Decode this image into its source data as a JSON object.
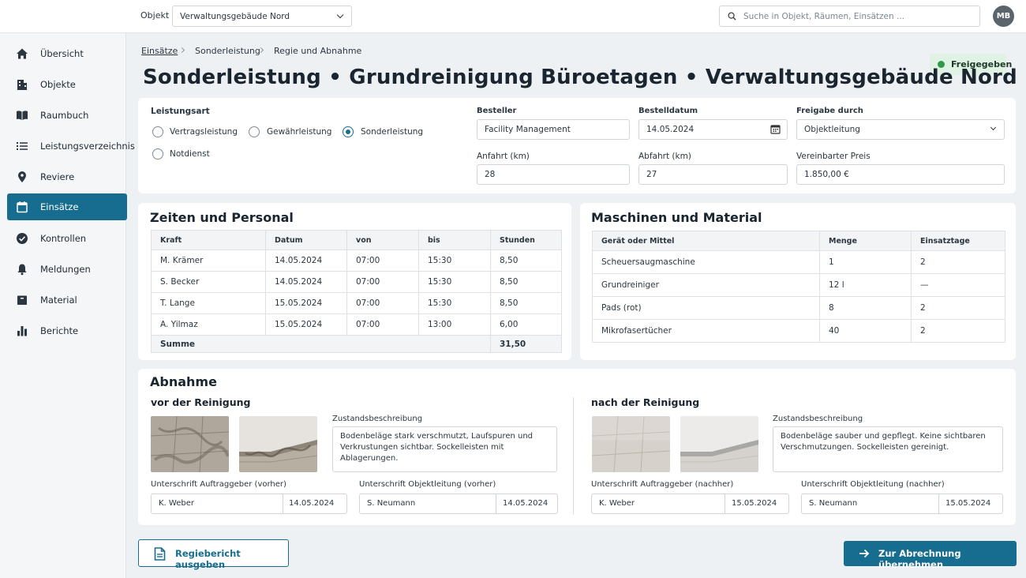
{
  "topbar": {
    "object_label": "Objekt",
    "object_value": "Verwaltungsgebäude Nord",
    "search_placeholder": "Suche in Objekt, Räumen, Einsätzen ...",
    "avatar_initials": "MB"
  },
  "sidebar": {
    "items": [
      {
        "label": "Übersicht",
        "icon": "home-icon",
        "active": false
      },
      {
        "label": "Objekte",
        "icon": "building-icon",
        "active": false
      },
      {
        "label": "Raumbuch",
        "icon": "book-icon",
        "active": false
      },
      {
        "label": "Leistungsverzeichnis",
        "icon": "list-icon",
        "active": false
      },
      {
        "label": "Reviere",
        "icon": "map-pin-icon",
        "active": false
      },
      {
        "label": "Einsätze",
        "icon": "calendar-icon",
        "active": true
      },
      {
        "label": "Kontrollen",
        "icon": "check-circle-icon",
        "active": false
      },
      {
        "label": "Meldungen",
        "icon": "bell-icon",
        "active": false
      },
      {
        "label": "Material",
        "icon": "box-icon",
        "active": false
      },
      {
        "label": "Berichte",
        "icon": "bar-chart-icon",
        "active": false
      }
    ]
  },
  "breadcrumb": [
    "Einsätze",
    "Sonderleistung",
    "Regie und Abnahme"
  ],
  "status_badge": "Freigegeben",
  "page_title": "Sonderleistung • Grundreinigung Büroetagen • Verwaltungsgebäude Nord",
  "form": {
    "leistungsart_label": "Leistungsart",
    "options": [
      "Vertragsleistung",
      "Gewährleistung",
      "Sonderleistung",
      "Notdienst"
    ],
    "selected": "Sonderleistung",
    "besteller_label": "Besteller",
    "besteller": "Facility Management",
    "bestelldatum_label": "Bestelldatum",
    "bestelldatum": "14.05.2024",
    "freigabe_label": "Freigabe durch",
    "freigabe": "Objektleitung",
    "anfahrt_label": "Anfahrt (km)",
    "anfahrt": "28",
    "abfahrt_label": "Abfahrt (km)",
    "abfahrt": "27",
    "preis_label": "Vereinbarter Preis",
    "preis": "1.850,00 €"
  },
  "personal": {
    "title": "Zeiten und Personal",
    "headers": [
      "Kraft",
      "Datum",
      "von",
      "bis",
      "Stunden"
    ],
    "rows": [
      [
        "M. Krämer",
        "14.05.2024",
        "07:00",
        "15:30",
        "8,50"
      ],
      [
        "S. Becker",
        "14.05.2024",
        "07:00",
        "15:30",
        "8,50"
      ],
      [
        "T. Lange",
        "15.05.2024",
        "07:00",
        "15:30",
        "8,50"
      ],
      [
        "A. Yilmaz",
        "15.05.2024",
        "07:00",
        "13:00",
        "6,00"
      ]
    ],
    "sum_label": "Summe",
    "sum_value": "31,50"
  },
  "material": {
    "title": "Maschinen und Material",
    "headers": [
      "Gerät oder Mittel",
      "Menge",
      "Einsatztage"
    ],
    "rows": [
      [
        "Scheuersaugmaschine",
        "1",
        "2"
      ],
      [
        "Grundreiniger",
        "12 l",
        "—"
      ],
      [
        "Pads (rot)",
        "8",
        "2"
      ],
      [
        "Mikrofasertücher",
        "40",
        "2"
      ]
    ]
  },
  "abnahme": {
    "title": "Abnahme",
    "before": {
      "title": "vor der Reinigung",
      "desc_label": "Zustandsbeschreibung",
      "desc": "Bodenbeläge stark verschmutzt, Laufspuren und Verkrustungen sichtbar. Sockelleisten mit Ablagerungen.",
      "sig_client_label": "Unterschrift Auftraggeber (vorher)",
      "sig_client_name": "K. Weber",
      "sig_client_date": "14.05.2024",
      "sig_lead_label": "Unterschrift Objektleitung (vorher)",
      "sig_lead_name": "S. Neumann",
      "sig_lead_date": "14.05.2024"
    },
    "after": {
      "title": "nach der Reinigung",
      "desc_label": "Zustandsbeschreibung",
      "desc": "Bodenbeläge sauber und gepflegt.  Keine sichtbaren Verschmutzungen. Sockelleisten gereinigt.",
      "sig_client_label": "Unterschrift Auftraggeber (nachher)",
      "sig_client_name": "K. Weber",
      "sig_client_date": "15.05.2024",
      "sig_lead_label": "Unterschrift Objektleitung (nachher)",
      "sig_lead_name": "S. Neumann",
      "sig_lead_date": "15.05.2024"
    }
  },
  "actions": {
    "report_button": "Regiebericht ausgeben",
    "submit_button": "Zur Abrechnung übernehmen"
  },
  "colors": {
    "primary": "#176d8f",
    "status_green": "#2f9a4a"
  }
}
